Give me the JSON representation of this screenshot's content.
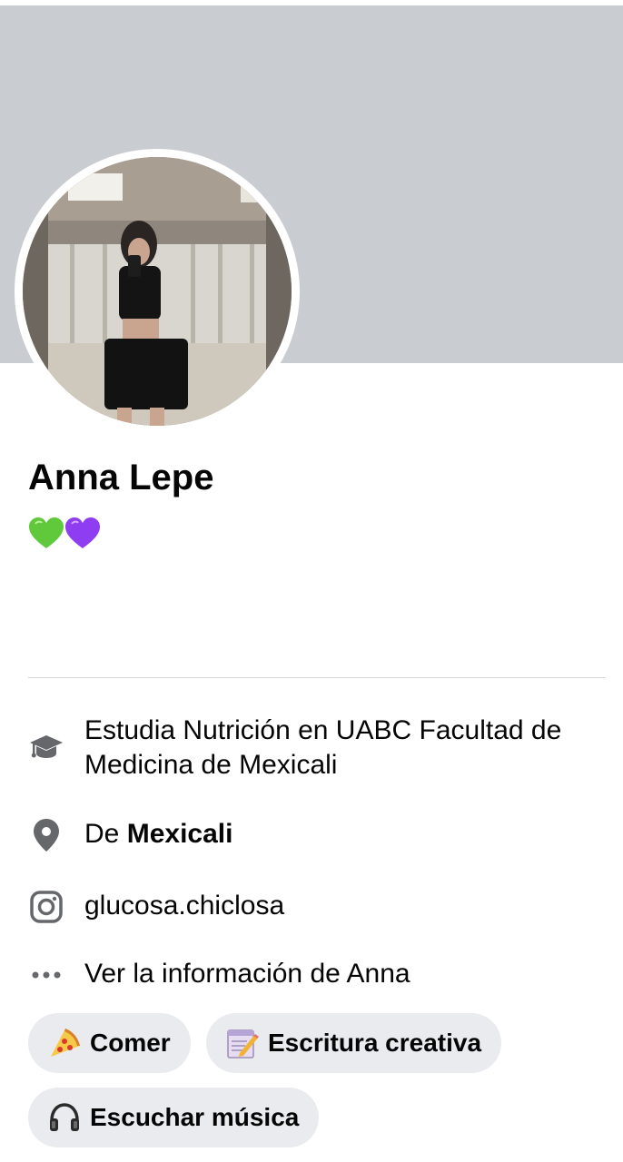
{
  "profile": {
    "name": "Anna Lepe",
    "bio_emojis": [
      "green-heart",
      "purple-heart"
    ]
  },
  "details": {
    "education": "Estudia Nutrición en UABC Facultad de Medicina de Mexicali",
    "hometown_prefix": "De",
    "hometown_city": "Mexicali",
    "instagram": "glucosa.chiclosa",
    "see_info": "Ver la información de Anna"
  },
  "hobbies": [
    {
      "emoji": "pizza",
      "label": "Comer"
    },
    {
      "emoji": "memo",
      "label": "Escritura creativa"
    },
    {
      "emoji": "headphones",
      "label": "Escuchar música"
    }
  ],
  "colors": {
    "cover": "#c9ccd1",
    "chip_bg": "#e9ebef",
    "icon_gray": "#65676b",
    "divider": "#d5d7db"
  }
}
